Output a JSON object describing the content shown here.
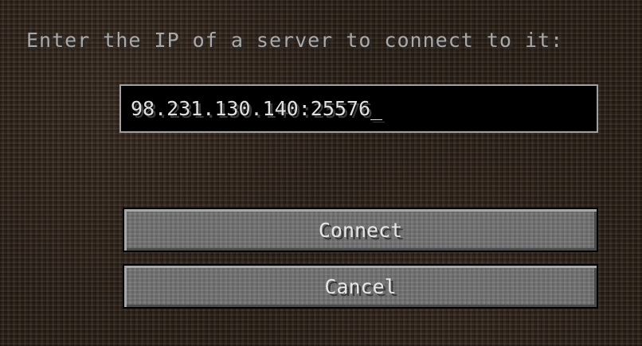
{
  "dialog": {
    "prompt": "Enter the IP of a server to connect to it:",
    "ip_value": "98.231.130.140:25576",
    "caret": "_",
    "connect_label": "Connect",
    "cancel_label": "Cancel"
  },
  "colors": {
    "prompt_text": "#a9a9a9",
    "field_background": "#000000",
    "field_border": "#a0a0a0",
    "button_face": "#727272",
    "button_text": "#e6e6e6"
  }
}
